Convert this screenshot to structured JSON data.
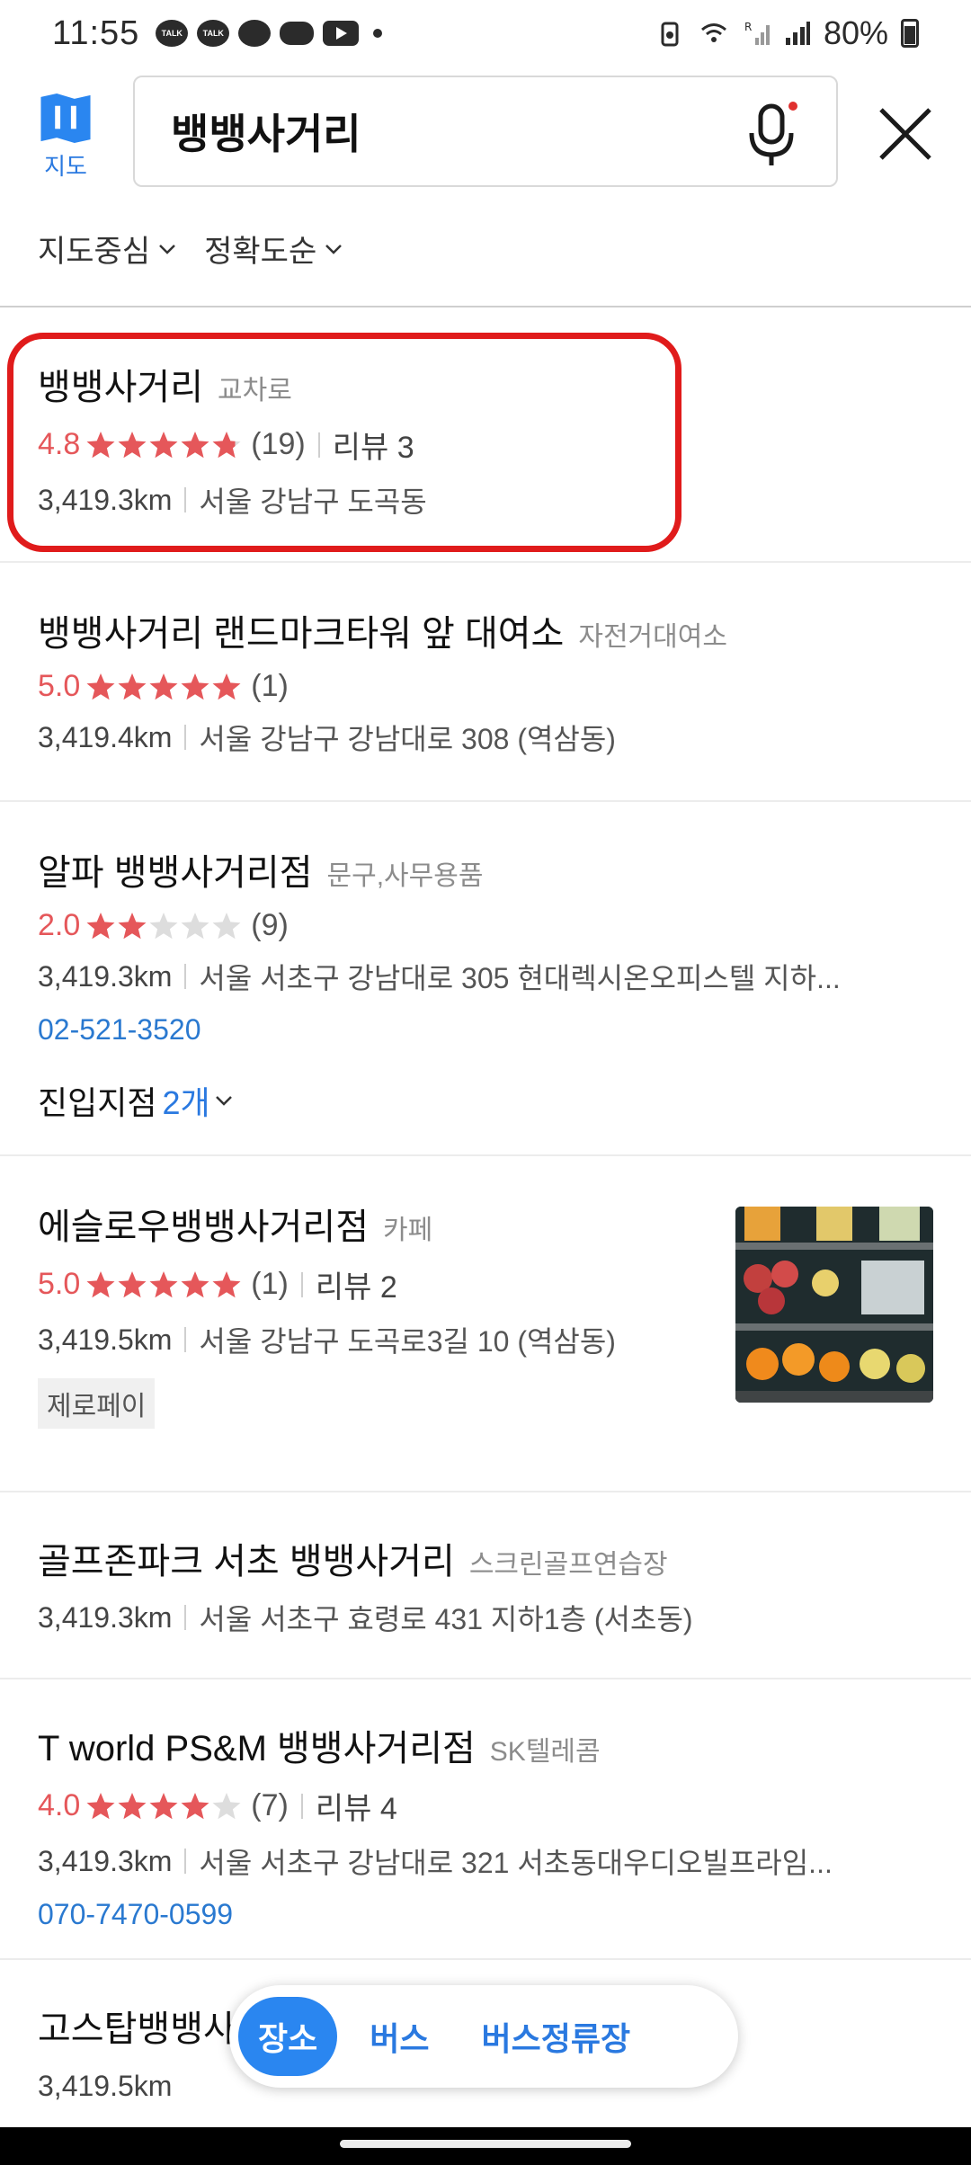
{
  "status_bar": {
    "time": "11:55",
    "battery": "80%",
    "icons": [
      "talk-icon",
      "talk-icon",
      "chat-bubble-icon",
      "game-icon",
      "youtube-icon",
      "dot-icon",
      "battery-saver-icon",
      "wifi-icon",
      "roaming-signal-icon",
      "signal-icon",
      "battery-icon"
    ]
  },
  "header": {
    "map_label": "지도",
    "search_value": "뱅뱅사거리"
  },
  "filters": [
    "지도중심",
    "정확도순"
  ],
  "results": [
    {
      "name": "뱅뱅사거리",
      "category": "교차로",
      "score": "4.8",
      "stars": 4.8,
      "count": "(19)",
      "review": "리뷰 3",
      "distance": "3,419.3km",
      "address": "서울 강남구 도곡동"
    },
    {
      "name": "뱅뱅사거리 랜드마크타워 앞 대여소",
      "category": "자전거대여소",
      "score": "5.0",
      "stars": 5,
      "count": "(1)",
      "distance": "3,419.4km",
      "address": "서울 강남구 강남대로 308 (역삼동)"
    },
    {
      "name": "알파 뱅뱅사거리점",
      "category": "문구,사무용품",
      "score": "2.0",
      "stars": 2,
      "count": "(9)",
      "distance": "3,419.3km",
      "address": "서울 서초구 강남대로 305 현대렉시온오피스텔 지하...",
      "phone": "02-521-3520",
      "entry_label": "진입지점",
      "entry_count": "2개"
    },
    {
      "name": "에슬로우뱅뱅사거리점",
      "category": "카페",
      "score": "5.0",
      "stars": 5,
      "count": "(1)",
      "review": "리뷰 2",
      "distance": "3,419.5km",
      "address": "서울 강남구 도곡로3길 10 (역삼동)",
      "tag": "제로페이"
    },
    {
      "name": "골프존파크 서초 뱅뱅사거리",
      "category": "스크린골프연습장",
      "distance": "3,419.3km",
      "address": "서울 서초구 효령로 431 지하1층 (서초동)"
    },
    {
      "name": "T world PS&M 뱅뱅사거리점",
      "category": "SK텔레콤",
      "score": "4.0",
      "stars": 4,
      "count": "(7)",
      "review": "리뷰 4",
      "distance": "3,419.3km",
      "address": "서울 서초구 강남대로 321 서초동대우디오빌프라임...",
      "phone": "070-7470-0599"
    },
    {
      "name": "고스탑뱅뱅사",
      "distance": "3,419.5km"
    }
  ],
  "bottom_tabs": [
    "장소",
    "버스",
    "버스정류장"
  ],
  "colors": {
    "accent": "#2a79e0",
    "rating": "#e5575a",
    "highlight": "#e01b1b"
  }
}
